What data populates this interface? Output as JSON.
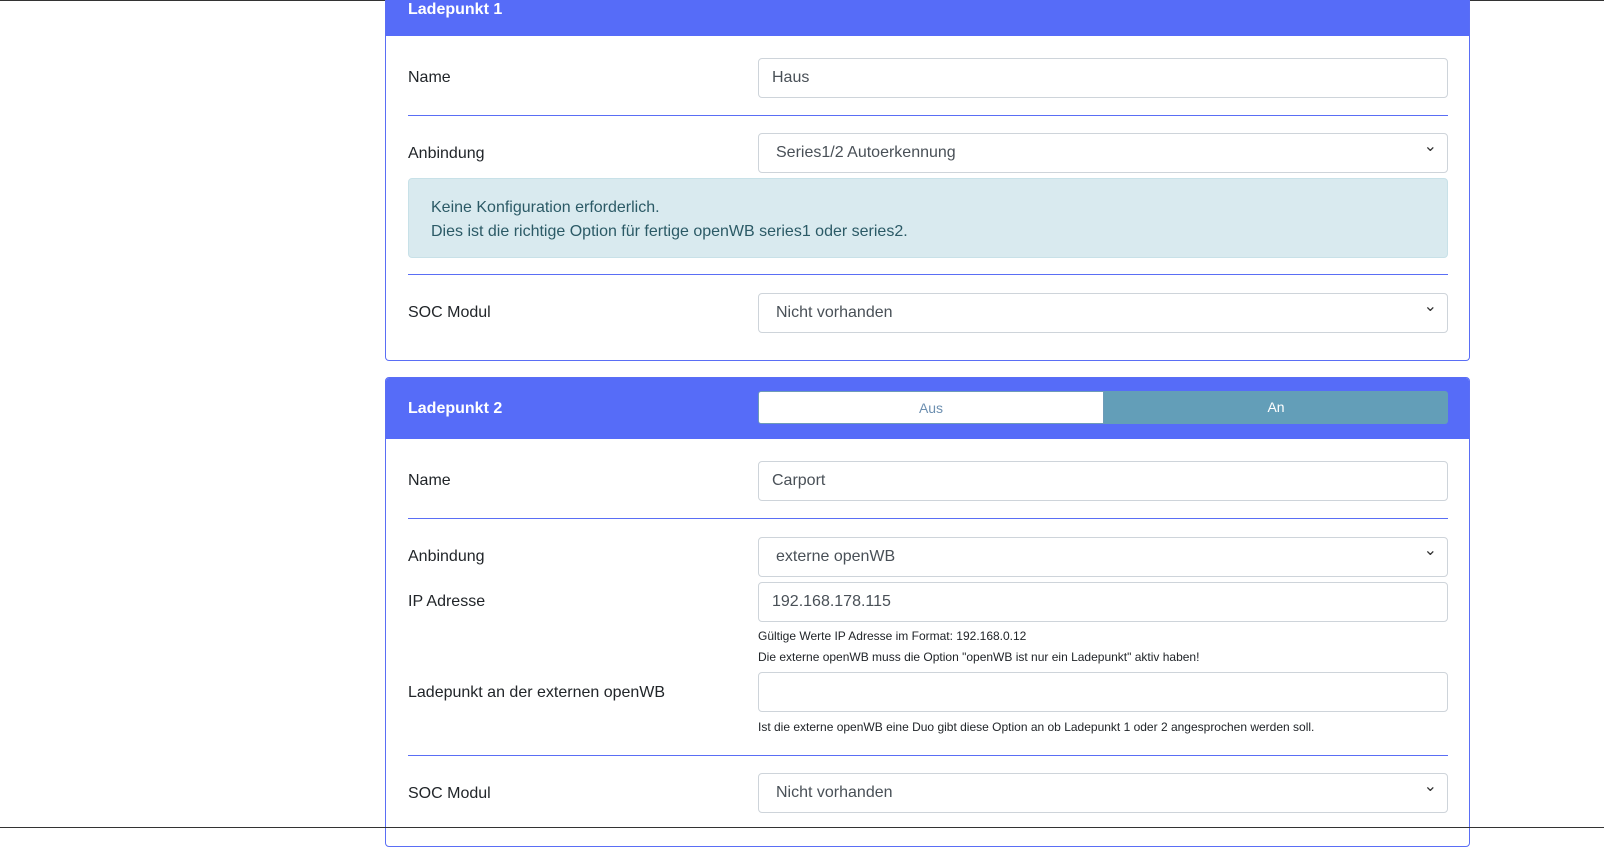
{
  "lp1": {
    "title": "Ladepunkt 1",
    "name_label": "Name",
    "name_value": "Haus",
    "anbindung_label": "Anbindung",
    "anbindung_value": "Series1/2 Autoerkennung",
    "info_line1": "Keine Konfiguration erforderlich.",
    "info_line2": "Dies ist die richtige Option für fertige openWB series1 oder series2.",
    "soc_label": "SOC Modul",
    "soc_value": "Nicht vorhanden"
  },
  "lp2": {
    "title": "Ladepunkt 2",
    "toggle_off": "Aus",
    "toggle_on": "An",
    "toggle_state": "An",
    "name_label": "Name",
    "name_value": "Carport",
    "anbindung_label": "Anbindung",
    "anbindung_value": "externe openWB",
    "ip_label": "IP Adresse",
    "ip_value": "192.168.178.115",
    "ip_help1": "Gültige Werte IP Adresse im Format: 192.168.0.12",
    "ip_help2": "Die externe openWB muss die Option \"openWB ist nur ein Ladepunkt\" aktiv haben!",
    "ext_lp_label": "Ladepunkt an der externen openWB",
    "ext_lp_value": "",
    "ext_lp_help": "Ist die externe openWB eine Duo gibt diese Option an ob Ladepunkt 1 oder 2 angesprochen werden soll.",
    "soc_label": "SOC Modul",
    "soc_value": "Nicht vorhanden"
  }
}
